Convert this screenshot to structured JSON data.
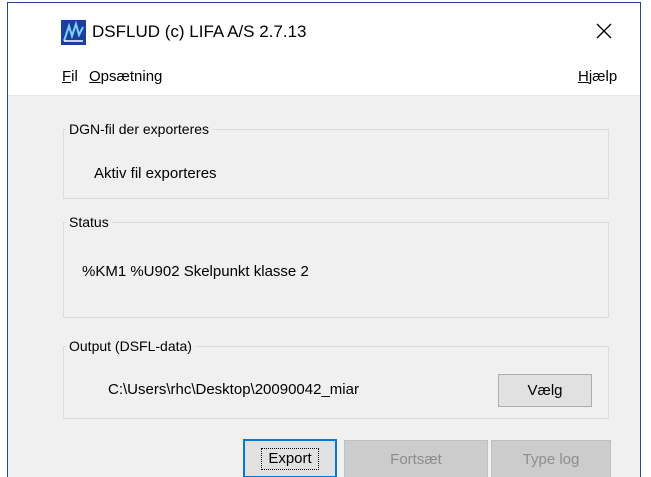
{
  "window": {
    "title": "DSFLUD (c) LIFA A/S 2.7.13",
    "close_symbol": "✕",
    "icon": "lifa-app-icon",
    "accent_color": "#0078d7",
    "border_color": "#1f4e8a"
  },
  "menu": {
    "fil": {
      "hotkey": "F",
      "rest": "il"
    },
    "opsaetning": {
      "hotkey": "O",
      "rest": "psætning"
    },
    "hjaelp": {
      "hotkey": "H",
      "rest": "jælp"
    }
  },
  "dgn_group": {
    "label": "DGN-fil der exporteres",
    "value": "Aktiv fil exporteres"
  },
  "status_group": {
    "label": "Status",
    "value": "%KM1 %U902 Skelpunkt klasse 2"
  },
  "output_group": {
    "label": "Output (DSFL-data)",
    "path": "C:\\Users\\rhc\\Desktop\\20090042_miar",
    "choose_label": "Vælg"
  },
  "buttons": {
    "export_label": "Export",
    "continue_label": "Fortsæt",
    "typelog_label": "Type log"
  }
}
